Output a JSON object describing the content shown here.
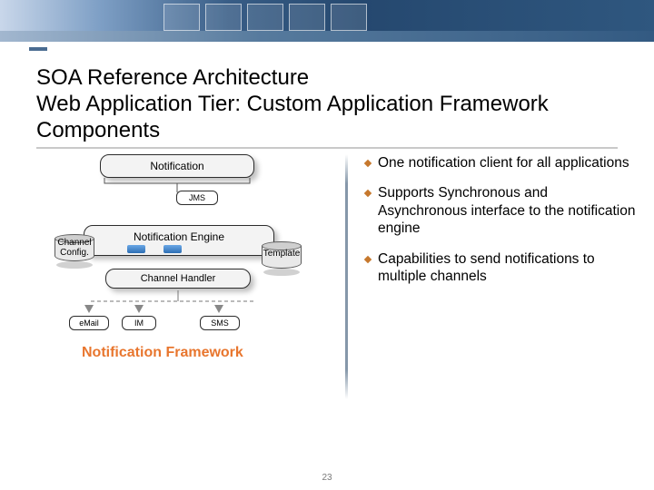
{
  "title": "SOA Reference Architecture\nWeb Application Tier: Custom Application Framework Components",
  "diagram": {
    "notification_box": "Notification",
    "jms": "JMS",
    "engine": "Notification Engine",
    "channel_config": "Channel\nConfig.",
    "template": "Template",
    "channel_handler": "Channel Handler",
    "email": "eMail",
    "im": "IM",
    "sms": "SMS",
    "section_title": "Notification Framework"
  },
  "bullets": [
    "One notification client for all applications",
    "Supports Synchronous and Asynchronous interface to the notification engine",
    "Capabilities to send notifications to multiple channels"
  ],
  "page_number": "23"
}
